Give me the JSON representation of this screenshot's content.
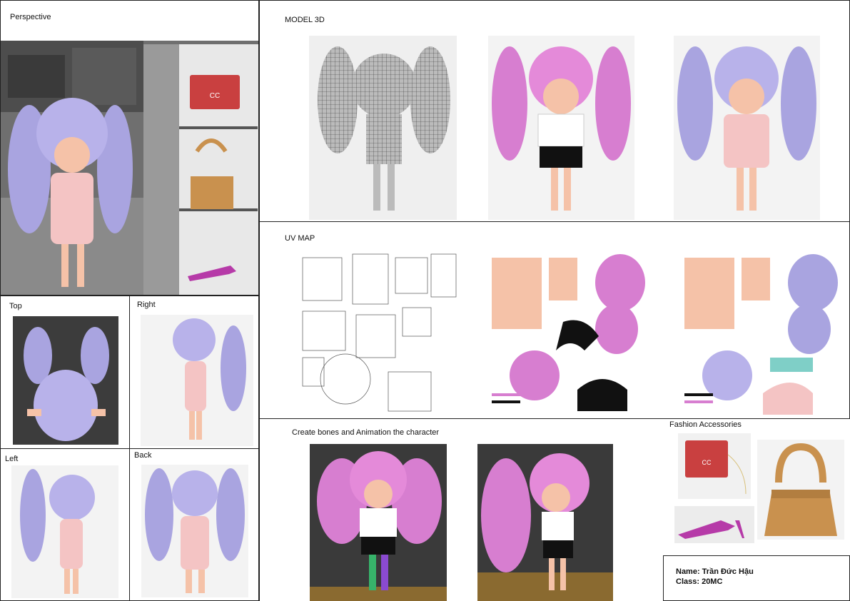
{
  "sections": {
    "perspective": "Perspective",
    "top": "Top",
    "right": "Right",
    "left": "Left",
    "back": "Back",
    "model_3d": "MODEL 3D",
    "uv_map": "UV MAP",
    "animation": "Create bones and Animation the character",
    "fashion": "Fashion Accessories"
  },
  "credits": {
    "name": "Name: Trần Đức Hậu",
    "class": "Class: 20MC"
  },
  "colors": {
    "hair_lavender": "#a9a4e0",
    "hair_pink": "#d77ed0",
    "skin": "#f5c2a8",
    "dress_pink": "#f4c4c4",
    "bag_red": "#c94040",
    "bag_tan": "#c9914e",
    "shoe_magenta": "#b63aa8"
  },
  "icons": [
    "character-render",
    "wireframe-render",
    "uv-layout",
    "handbag-icon",
    "shoe-icon"
  ]
}
